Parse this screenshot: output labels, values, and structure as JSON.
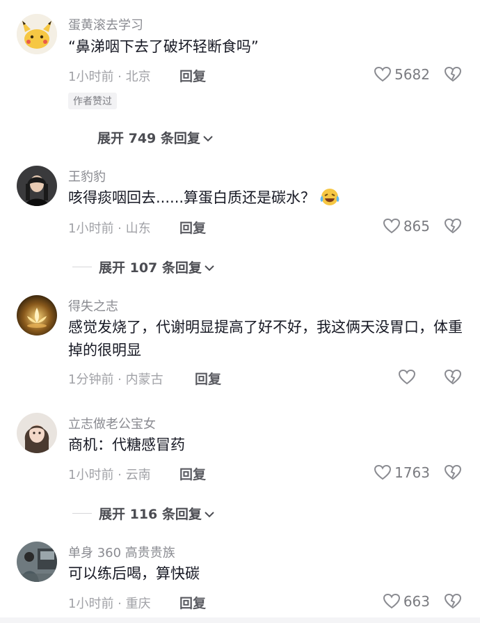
{
  "comments": [
    {
      "username": "蛋黄滚去学习",
      "text": "“鼻涕咽下去了破坏轻断食吗”",
      "time_location": "1小时前 · 北京",
      "reply_label": "回复",
      "likes": "5682",
      "badge": "作者赞过"
    },
    {
      "username": "王豹豹",
      "text": "咳得痰咽回去......算蛋白质还是碳水？",
      "time_location": "1小时前 · 山东",
      "reply_label": "回复",
      "likes": "865"
    },
    {
      "username": "得失之志",
      "text": "感觉发烧了，代谢明显提高了好不好，我这俩天没胃口，体重掉的很明显",
      "time_location": "1分钟前 · 内蒙古",
      "reply_label": "回复",
      "likes": ""
    },
    {
      "username": "立志做老公宝女",
      "text": "商机：代糖感冒药",
      "time_location": "1小时前 · 云南",
      "reply_label": "回复",
      "likes": "1763"
    },
    {
      "username": "单身 360 高贵贵族",
      "text": "可以练后喝，算快碳",
      "time_location": "1小时前 · 重庆",
      "reply_label": "回复",
      "likes": "663"
    }
  ],
  "expanders": [
    {
      "label": "展开 749 条回复"
    },
    {
      "label": "展开 107 条回复"
    },
    {
      "label": "展开 116 条回复"
    }
  ],
  "icons": {
    "like": "heart-outline-icon",
    "dislike": "broken-heart-icon",
    "expand": "chevron-down-icon",
    "emoji": "laughing-crying-emoji"
  },
  "colors": {
    "text": "#161823",
    "secondary": "#8a8b91",
    "emoji_yellow": "#f6c744"
  }
}
